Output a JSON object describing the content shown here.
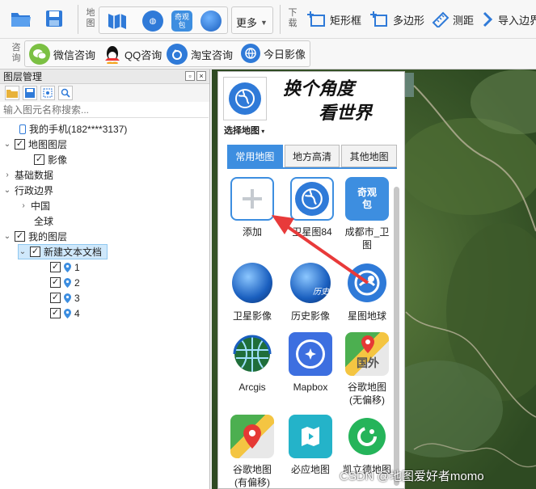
{
  "toolbar": {
    "map_group_label": "地图",
    "more_label": "更多",
    "download_group_label": "下载",
    "rect_label": "矩形框",
    "polygon_label": "多边形",
    "measure_label": "测距",
    "import_label": "导入边界",
    "mid_icon_text": "奇观\n包"
  },
  "consult": {
    "group_label": "咨询",
    "items": [
      {
        "label": "微信咨询",
        "icon": "wechat-icon",
        "color": "#7bc043"
      },
      {
        "label": "QQ咨询",
        "icon": "qq-icon",
        "color": "#111111"
      },
      {
        "label": "淘宝咨询",
        "icon": "taobao-icon",
        "color": "#2f7ad8"
      },
      {
        "label": "今日影像",
        "icon": "globe-icon",
        "color": "#2f7ad8"
      }
    ]
  },
  "layer_panel": {
    "title": "图层管理",
    "search_placeholder": "输入图元名称搜索...",
    "tree": {
      "phone": "我的手机(182****3137)",
      "map_layers": "地图图层",
      "imagery": "影像",
      "basic_data": "基础数据",
      "admin_boundary": "行政边界",
      "china": "中国",
      "global": "全球",
      "my_layers": "我的图层",
      "new_text_doc": "新建文本文档",
      "points": [
        "1",
        "2",
        "3",
        "4"
      ]
    }
  },
  "picker": {
    "select_map_label": "选择地图",
    "slogan_line1": "换个角度",
    "slogan_line2": "看世界",
    "tabs": [
      "常用地图",
      "地方高清",
      "其他地图"
    ],
    "tiles": [
      {
        "label": "添加",
        "icon": "add-icon"
      },
      {
        "label": "卫星图84",
        "icon": "globe-icon"
      },
      {
        "label": "成都市_卫\n图",
        "icon": "qiguan-package-icon",
        "icon_text": "奇观\n包"
      },
      {
        "label": "卫星影像",
        "icon": "google-earth-icon"
      },
      {
        "label": "历史影像",
        "icon": "history-earth-icon",
        "icon_text": "历史"
      },
      {
        "label": "星图地球",
        "icon": "geovis-icon"
      },
      {
        "label": "Arcgis",
        "icon": "arcgis-icon"
      },
      {
        "label": "Mapbox",
        "icon": "mapbox-icon"
      },
      {
        "label": "谷歌地图\n(无偏移)",
        "icon": "google-map-foreign-icon",
        "icon_text": "国外"
      },
      {
        "label": "谷歌地图\n(有偏移)",
        "icon": "google-map-icon"
      },
      {
        "label": "必应地图",
        "icon": "bing-map-icon"
      },
      {
        "label": "凯立德地图",
        "icon": "careland-icon"
      }
    ]
  },
  "watermark": "CSDN @地图爱好者momo",
  "colors": {
    "accent": "#3d8ee0",
    "arrow": "#e83a3a"
  }
}
